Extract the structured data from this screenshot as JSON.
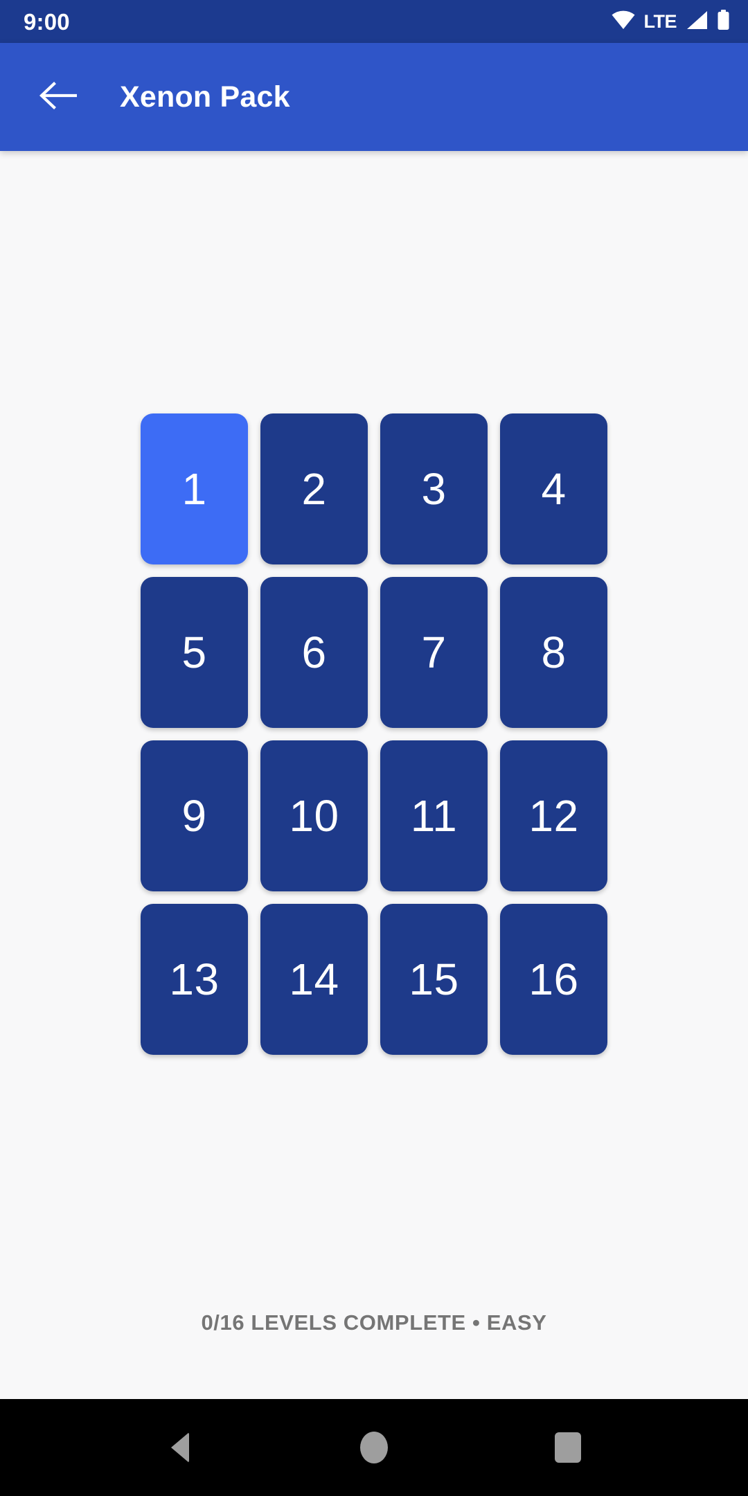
{
  "status_bar": {
    "time": "9:00",
    "network_label": "LTE",
    "icons": [
      "wifi-icon",
      "lte-label",
      "cellular-signal-icon",
      "battery-icon"
    ],
    "background_color": "#1c3a8f"
  },
  "app_bar": {
    "back_icon": "arrow-left-icon",
    "title": "Xenon Pack",
    "background_color": "#2f55c8"
  },
  "level_grid": {
    "columns": 4,
    "rows": 4,
    "current_level": 1,
    "tile_color": "#1e3a8a",
    "current_tile_color": "#3d6cf5",
    "levels": [
      {
        "label": "1",
        "state": "current"
      },
      {
        "label": "2",
        "state": "locked"
      },
      {
        "label": "3",
        "state": "locked"
      },
      {
        "label": "4",
        "state": "locked"
      },
      {
        "label": "5",
        "state": "locked"
      },
      {
        "label": "6",
        "state": "locked"
      },
      {
        "label": "7",
        "state": "locked"
      },
      {
        "label": "8",
        "state": "locked"
      },
      {
        "label": "9",
        "state": "locked"
      },
      {
        "label": "10",
        "state": "locked"
      },
      {
        "label": "11",
        "state": "locked"
      },
      {
        "label": "12",
        "state": "locked"
      },
      {
        "label": "13",
        "state": "locked"
      },
      {
        "label": "14",
        "state": "locked"
      },
      {
        "label": "15",
        "state": "locked"
      },
      {
        "label": "16",
        "state": "locked"
      }
    ]
  },
  "footer": {
    "status_text": "0/16 LEVELS COMPLETE • EASY",
    "levels_complete": 0,
    "levels_total": 16,
    "difficulty": "EASY"
  },
  "nav_bar": {
    "back_label": "Back",
    "home_label": "Home",
    "recents_label": "Recents",
    "background_color": "#000000"
  }
}
